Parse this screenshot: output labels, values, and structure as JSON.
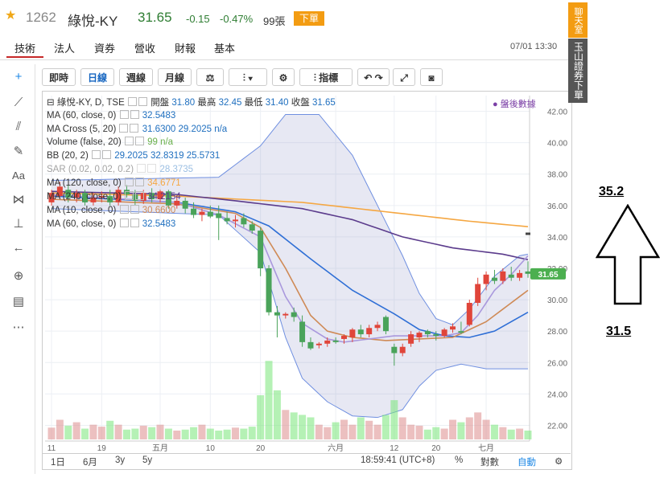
{
  "header": {
    "star_icon": "star-icon",
    "code": "1262",
    "name": "綠悅-KY",
    "price": "31.65",
    "change": "-0.15",
    "change_pct": "-0.47%",
    "volume": "99張",
    "order_button": "下單",
    "colors": {
      "down": "#2e7d32",
      "accent": "#f39c12"
    }
  },
  "tabs": [
    "技術",
    "法人",
    "資券",
    "營收",
    "財報",
    "基本"
  ],
  "active_tab": "技術",
  "datetime": "07/01 13:30",
  "toolbar": {
    "buttons": [
      "即時",
      "日線",
      "週線",
      "月線"
    ],
    "active": "日線",
    "indicators_label": "指標"
  },
  "side_buttons": {
    "chat": "聊天室",
    "broker": "玉山證券下單"
  },
  "legend": {
    "main": {
      "label": "綠悅-KY, D, TSE",
      "open_label": "開盤",
      "open": "31.80",
      "high_label": "最高",
      "high": "32.45",
      "low_label": "最低",
      "low": "31.40",
      "close_label": "收盤",
      "close": "31.65"
    },
    "after_hours": "盤後數據",
    "rows": [
      {
        "label": "MA (60, close, 0)",
        "values": "32.5483"
      },
      {
        "label": "MA Cross (5, 20)",
        "values": "31.6300  29.2025  n/a"
      },
      {
        "label": "Volume (false, 20)",
        "values": "99  n/a"
      },
      {
        "label": "BB (20, 2)",
        "values": "29.2025  32.8319  25.5731"
      },
      {
        "label": "SAR (0.02, 0.02, 0.2)",
        "values": "28.3735"
      },
      {
        "label": "MA (120, close, 0)",
        "values": "34.6771"
      },
      {
        "label": "MA (240, close, 0)",
        "values": "34.2154"
      },
      {
        "label": "MA (10, close, 0)",
        "values": "30.6600"
      },
      {
        "label": "MA (60, close, 0)",
        "values": "32.5483"
      }
    ]
  },
  "bottom_bar": {
    "periods": [
      "1日",
      "6月",
      "3y",
      "5y"
    ],
    "time": "18:59:41 (UTC+8)",
    "pct": "%",
    "log": "對數",
    "auto": "自動"
  },
  "annotations": {
    "upper": "35.2",
    "lower": "31.5"
  },
  "chart_data": {
    "type": "candlestick",
    "yaxis": {
      "min": 21,
      "max": 43,
      "ticks": [
        22,
        24,
        26,
        28,
        30,
        32,
        34,
        36,
        38,
        40,
        42
      ]
    },
    "last_price_label": "31.65",
    "x_tick_labels": [
      {
        "label": "11",
        "i": 0
      },
      {
        "label": "19",
        "i": 6
      },
      {
        "label": "五月",
        "i": 13
      },
      {
        "label": "10",
        "i": 19
      },
      {
        "label": "20",
        "i": 25
      },
      {
        "label": "六月",
        "i": 34
      },
      {
        "label": "12",
        "i": 41
      },
      {
        "label": "20",
        "i": 46
      },
      {
        "label": "七月",
        "i": 52
      }
    ],
    "candles": [
      {
        "o": 36.2,
        "h": 37.0,
        "l": 36.0,
        "c": 36.8
      },
      {
        "o": 36.6,
        "h": 37.5,
        "l": 36.5,
        "c": 37.2
      },
      {
        "o": 37.0,
        "h": 37.3,
        "l": 36.2,
        "c": 36.5
      },
      {
        "o": 36.5,
        "h": 37.0,
        "l": 36.2,
        "c": 36.8
      },
      {
        "o": 36.8,
        "h": 37.0,
        "l": 36.0,
        "c": 36.2
      },
      {
        "o": 36.2,
        "h": 36.8,
        "l": 36.0,
        "c": 36.5
      },
      {
        "o": 36.5,
        "h": 36.9,
        "l": 36.2,
        "c": 36.6
      },
      {
        "o": 36.6,
        "h": 37.0,
        "l": 36.0,
        "c": 36.2
      },
      {
        "o": 36.2,
        "h": 37.2,
        "l": 36.0,
        "c": 37.0
      },
      {
        "o": 37.0,
        "h": 37.3,
        "l": 36.5,
        "c": 36.7
      },
      {
        "o": 36.7,
        "h": 37.0,
        "l": 36.0,
        "c": 36.3
      },
      {
        "o": 36.3,
        "h": 37.0,
        "l": 36.1,
        "c": 36.8
      },
      {
        "o": 36.8,
        "h": 37.1,
        "l": 36.2,
        "c": 36.4
      },
      {
        "o": 36.4,
        "h": 37.0,
        "l": 36.2,
        "c": 36.9
      },
      {
        "o": 36.9,
        "h": 37.0,
        "l": 35.8,
        "c": 36.0
      },
      {
        "o": 36.0,
        "h": 36.6,
        "l": 35.8,
        "c": 36.3
      },
      {
        "o": 36.3,
        "h": 36.5,
        "l": 35.5,
        "c": 35.8
      },
      {
        "o": 35.8,
        "h": 36.2,
        "l": 35.2,
        "c": 35.4
      },
      {
        "o": 35.4,
        "h": 35.8,
        "l": 35.0,
        "c": 35.6
      },
      {
        "o": 35.6,
        "h": 36.0,
        "l": 35.2,
        "c": 35.3
      },
      {
        "o": 35.5,
        "h": 36.0,
        "l": 33.8,
        "c": 35.2
      },
      {
        "o": 35.2,
        "h": 35.6,
        "l": 34.8,
        "c": 35.0
      },
      {
        "o": 35.0,
        "h": 35.4,
        "l": 34.6,
        "c": 35.1
      },
      {
        "o": 35.2,
        "h": 35.5,
        "l": 34.6,
        "c": 34.8
      },
      {
        "o": 34.8,
        "h": 35.0,
        "l": 34.2,
        "c": 34.4
      },
      {
        "o": 34.4,
        "h": 34.6,
        "l": 31.5,
        "c": 32.0
      },
      {
        "o": 32.0,
        "h": 32.2,
        "l": 29.0,
        "c": 29.2
      },
      {
        "o": 29.2,
        "h": 29.6,
        "l": 27.6,
        "c": 29.0
      },
      {
        "o": 29.0,
        "h": 29.2,
        "l": 28.8,
        "c": 29.1
      },
      {
        "o": 29.2,
        "h": 29.5,
        "l": 28.6,
        "c": 28.9
      },
      {
        "o": 28.6,
        "h": 29.0,
        "l": 27.0,
        "c": 27.3
      },
      {
        "o": 27.3,
        "h": 27.6,
        "l": 26.8,
        "c": 26.9
      },
      {
        "o": 27.1,
        "h": 27.3,
        "l": 26.9,
        "c": 27.2
      },
      {
        "o": 27.2,
        "h": 27.6,
        "l": 27.0,
        "c": 27.4
      },
      {
        "o": 27.4,
        "h": 27.6,
        "l": 27.2,
        "c": 27.3
      },
      {
        "o": 27.5,
        "h": 27.8,
        "l": 27.2,
        "c": 27.7
      },
      {
        "o": 27.6,
        "h": 28.2,
        "l": 27.3,
        "c": 28.1
      },
      {
        "o": 28.1,
        "h": 28.4,
        "l": 27.6,
        "c": 27.8
      },
      {
        "o": 27.8,
        "h": 28.4,
        "l": 27.6,
        "c": 28.2
      },
      {
        "o": 28.2,
        "h": 28.6,
        "l": 28.0,
        "c": 28.4
      },
      {
        "o": 28.9,
        "h": 29.0,
        "l": 27.8,
        "c": 28.0
      },
      {
        "o": 27.0,
        "h": 27.2,
        "l": 25.8,
        "c": 26.6
      },
      {
        "o": 26.6,
        "h": 27.2,
        "l": 26.4,
        "c": 27.0
      },
      {
        "o": 27.2,
        "h": 28.0,
        "l": 27.0,
        "c": 27.8
      },
      {
        "o": 27.6,
        "h": 28.0,
        "l": 27.3,
        "c": 27.9
      },
      {
        "o": 28.0,
        "h": 28.1,
        "l": 27.6,
        "c": 27.8
      },
      {
        "o": 27.8,
        "h": 28.0,
        "l": 27.4,
        "c": 27.7
      },
      {
        "o": 27.7,
        "h": 28.2,
        "l": 27.6,
        "c": 28.1
      },
      {
        "o": 28.1,
        "h": 28.5,
        "l": 27.9,
        "c": 28.3
      },
      {
        "o": 28.0,
        "h": 28.6,
        "l": 27.8,
        "c": 27.9
      },
      {
        "o": 28.4,
        "h": 30.0,
        "l": 28.3,
        "c": 29.8
      },
      {
        "o": 29.8,
        "h": 31.4,
        "l": 29.6,
        "c": 31.0
      },
      {
        "o": 31.0,
        "h": 31.8,
        "l": 30.6,
        "c": 31.6
      },
      {
        "o": 31.4,
        "h": 31.9,
        "l": 31.0,
        "c": 31.2
      },
      {
        "o": 31.2,
        "h": 32.0,
        "l": 31.0,
        "c": 31.8
      },
      {
        "o": 31.6,
        "h": 32.1,
        "l": 31.2,
        "c": 31.4
      },
      {
        "o": 31.4,
        "h": 31.9,
        "l": 31.2,
        "c": 31.7
      },
      {
        "o": 31.8,
        "h": 32.45,
        "l": 31.4,
        "c": 31.65
      }
    ],
    "volume": [
      24,
      40,
      28,
      35,
      22,
      30,
      26,
      38,
      30,
      20,
      22,
      28,
      25,
      30,
      22,
      18,
      20,
      25,
      30,
      22,
      18,
      20,
      24,
      22,
      26,
      90,
      160,
      100,
      60,
      55,
      50,
      45,
      30,
      25,
      35,
      40,
      30,
      45,
      38,
      30,
      50,
      80,
      45,
      30,
      28,
      20,
      25,
      22,
      40,
      35,
      45,
      55,
      40,
      30,
      25,
      20,
      22,
      18
    ],
    "volume_max": 180,
    "series": [
      {
        "name": "BB",
        "upper": [
          [
            0,
            37.6
          ],
          [
            20,
            37.8
          ],
          [
            25,
            39.8
          ],
          [
            28,
            41.8
          ],
          [
            32,
            41.8
          ],
          [
            36,
            39.2
          ],
          [
            39,
            36.0
          ],
          [
            42,
            32.8
          ],
          [
            44,
            30.4
          ],
          [
            46,
            28.8
          ],
          [
            48,
            28.4
          ],
          [
            50,
            29.4
          ],
          [
            53,
            31.5
          ],
          [
            56,
            32.8
          ],
          [
            57,
            32.9
          ]
        ],
        "lower": [
          [
            0,
            35.8
          ],
          [
            20,
            35.4
          ],
          [
            25,
            33.0
          ],
          [
            28,
            27.6
          ],
          [
            30,
            25.0
          ],
          [
            33,
            23.5
          ],
          [
            36,
            22.6
          ],
          [
            39,
            22.5
          ],
          [
            42,
            23.0
          ],
          [
            44,
            24.5
          ],
          [
            46,
            25.5
          ],
          [
            49,
            25.9
          ],
          [
            52,
            25.6
          ],
          [
            57,
            25.6
          ]
        ]
      },
      {
        "name": "MA (240, close, 0)",
        "color": "#f5a742",
        "points": [
          [
            0,
            36.8
          ],
          [
            15,
            36.6
          ],
          [
            30,
            36.2
          ],
          [
            40,
            35.6
          ],
          [
            50,
            35.0
          ],
          [
            57,
            34.65
          ]
        ]
      },
      {
        "name": "MA (120, close, 0)",
        "color": "#5b3b8c",
        "points": [
          [
            0,
            36.9
          ],
          [
            15,
            36.7
          ],
          [
            22,
            36.3
          ],
          [
            30,
            35.8
          ],
          [
            36,
            35.1
          ],
          [
            42,
            34.0
          ],
          [
            48,
            33.3
          ],
          [
            54,
            32.9
          ],
          [
            57,
            32.55
          ]
        ]
      },
      {
        "name": "MA (60, close, 0)",
        "color": "#2f6fd6",
        "points": [
          [
            0,
            36.6
          ],
          [
            15,
            36.2
          ],
          [
            22,
            35.6
          ],
          [
            26,
            34.7
          ],
          [
            31,
            32.6
          ],
          [
            36,
            30.6
          ],
          [
            41,
            29.1
          ],
          [
            44,
            28.1
          ],
          [
            47,
            27.7
          ],
          [
            50,
            27.6
          ],
          [
            53,
            28.0
          ],
          [
            57,
            29.2
          ]
        ]
      },
      {
        "name": "MA (20, close, 0)",
        "color": "#cf8a56",
        "points": [
          [
            0,
            36.4
          ],
          [
            15,
            36.1
          ],
          [
            22,
            35.5
          ],
          [
            25,
            34.6
          ],
          [
            28,
            32.0
          ],
          [
            31,
            29.0
          ],
          [
            33,
            28.0
          ],
          [
            36,
            27.6
          ],
          [
            40,
            27.4
          ],
          [
            44,
            27.5
          ],
          [
            48,
            27.6
          ],
          [
            52,
            28.6
          ],
          [
            55,
            29.8
          ],
          [
            57,
            30.6
          ]
        ]
      },
      {
        "name": "MA (10, close, 0)",
        "color": "#a998dd",
        "points": [
          [
            0,
            36.7
          ],
          [
            15,
            36.2
          ],
          [
            20,
            35.4
          ],
          [
            25,
            34.0
          ],
          [
            28,
            30.2
          ],
          [
            30,
            28.5
          ],
          [
            33,
            27.5
          ],
          [
            35,
            27.3
          ],
          [
            38,
            27.5
          ],
          [
            41,
            27.7
          ],
          [
            44,
            27.7
          ],
          [
            47,
            27.7
          ],
          [
            49,
            27.9
          ],
          [
            51,
            29.0
          ],
          [
            53,
            30.6
          ],
          [
            55,
            31.6
          ],
          [
            57,
            32.8
          ]
        ]
      },
      {
        "name": "SAR (0.02, 0.02, 0.2)",
        "color": "#444",
        "points": [
          [
            57,
            34.2
          ]
        ]
      }
    ]
  }
}
